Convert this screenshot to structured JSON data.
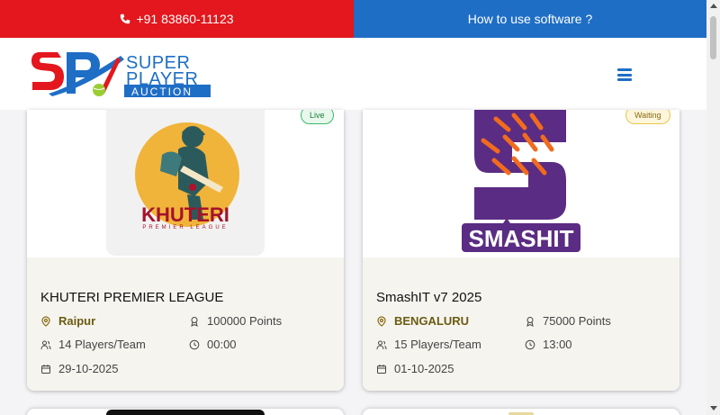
{
  "topbar": {
    "phone": "+91 83860-11123",
    "howto": "How to use software ?"
  },
  "logo": {
    "line1": "SUPER",
    "line2": "PLAYER",
    "line3": "AUCTION",
    "mark": "SPA"
  },
  "colors": {
    "red": "#e3171d",
    "blue": "#1f6ec5",
    "card_body": "#f5f4ef",
    "smashit_purple": "#5b2c83",
    "smashit_orange": "#f26b1d"
  },
  "cards": [
    {
      "status": "Live",
      "logo_text": "KHUTERI",
      "logo_sub": "PREMIER LEAGUE",
      "title": "KHUTERI PREMIER LEAGUE",
      "city": "Raipur",
      "points": "100000 Points",
      "players": "14 Players/Team",
      "time": "00:00",
      "date": "29-10-2025"
    },
    {
      "status": "Waiting",
      "logo_text": "SMASHIT",
      "title": "SmashIT v7 2025",
      "city": "BENGALURU",
      "points": "75000 Points",
      "players": "15 Players/Team",
      "time": "13:00",
      "date": "01-10-2025"
    }
  ]
}
